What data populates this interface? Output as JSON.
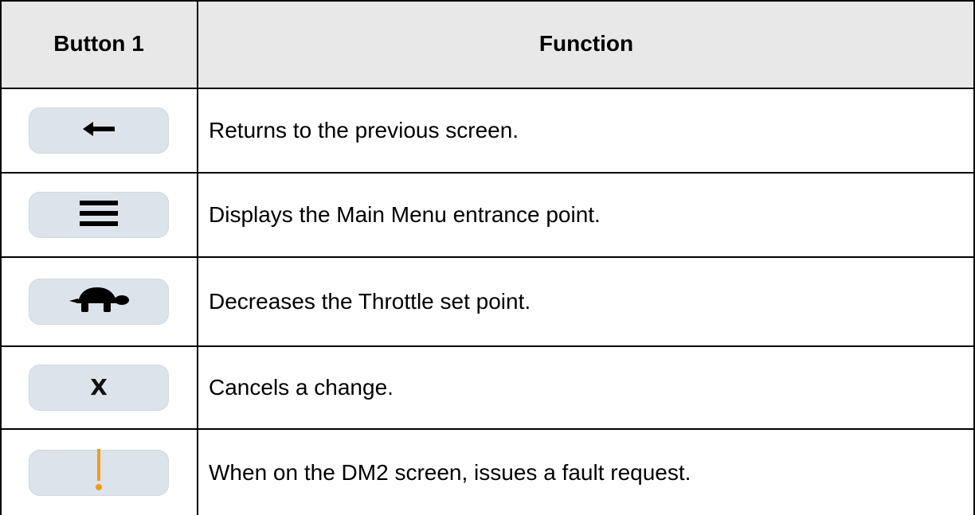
{
  "table": {
    "header": {
      "col1": "Button 1",
      "col2": "Function"
    },
    "rows": [
      {
        "icon": "left-arrow-icon",
        "function": "Returns to the previous screen."
      },
      {
        "icon": "hamburger-menu-icon",
        "function": "Displays the Main Menu entrance point."
      },
      {
        "icon": "turtle-icon",
        "function": "Decreases the Throttle set point."
      },
      {
        "icon": "x-icon",
        "glyph": "X",
        "function": "Cancels a change."
      },
      {
        "icon": "exclamation-icon",
        "function": "When on the DM2 screen, issues a fault request."
      }
    ]
  },
  "colors": {
    "button_fill": "#dde3ea",
    "header_fill": "#e8e8e8",
    "exclamation": "#f39c1b",
    "text": "#000000"
  }
}
